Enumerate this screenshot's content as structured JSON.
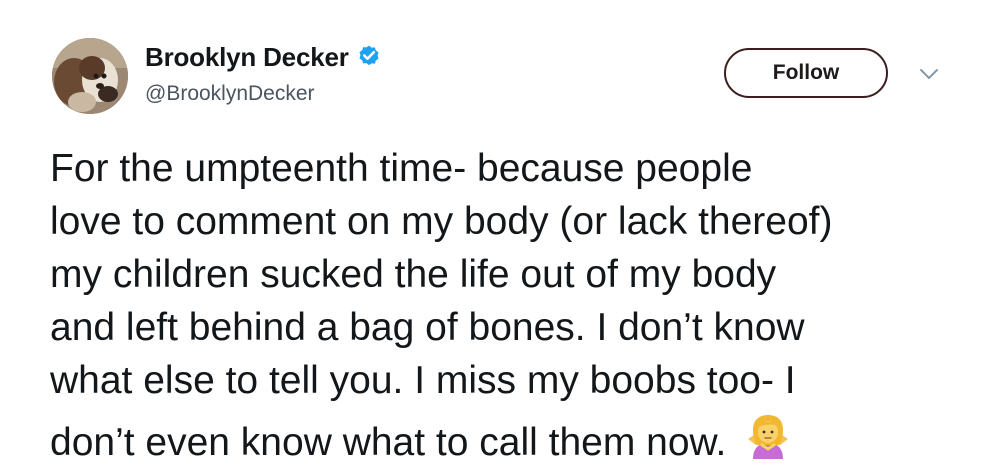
{
  "author": {
    "display_name": "Brooklyn Decker",
    "handle": "@BrooklynDecker",
    "verified": true,
    "avatar_icon": "profile-photo"
  },
  "actions": {
    "follow_label": "Follow",
    "menu_icon": "chevron-down-icon"
  },
  "tweet": {
    "lines": [
      "For the umpteenth time- because people",
      "love to comment on my body (or lack thereof)",
      "my children sucked the life out of my body",
      "and left behind a bag of bones. I don’t know",
      "what else to tell you. I miss my boobs too- I",
      "don’t even know what to call them now."
    ],
    "emoji": "person-shrugging-emoji"
  },
  "colors": {
    "verified_blue": "#1da1f2",
    "text_primary": "#14171a",
    "text_secondary": "#4a5560",
    "follow_border": "#3b1e1e"
  }
}
